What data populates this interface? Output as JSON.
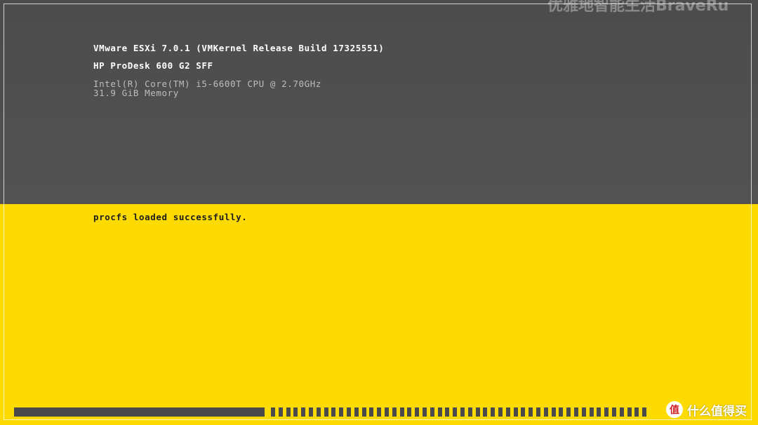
{
  "info": {
    "version_line": "VMware ESXi 7.0.1 (VMKernel Release Build 17325551)",
    "host_line": "HP ProDesk 600 G2 SFF",
    "cpu_line": "Intel(R) Core(TM) i5-6600T CPU @ 2.70GHz",
    "memory_line": "31.9 GiB Memory"
  },
  "status": {
    "message": "procfs loaded successfully."
  },
  "progress": {
    "fraction": 0.4
  },
  "watermark": {
    "text": "优雅地智能生活BraveRu"
  },
  "brand": {
    "logo_char": "值",
    "text": "什么值得买"
  },
  "colors": {
    "top_bg": "#4c4c4c",
    "bottom_bg": "#fedb00",
    "progress": "#4a4a4a"
  }
}
